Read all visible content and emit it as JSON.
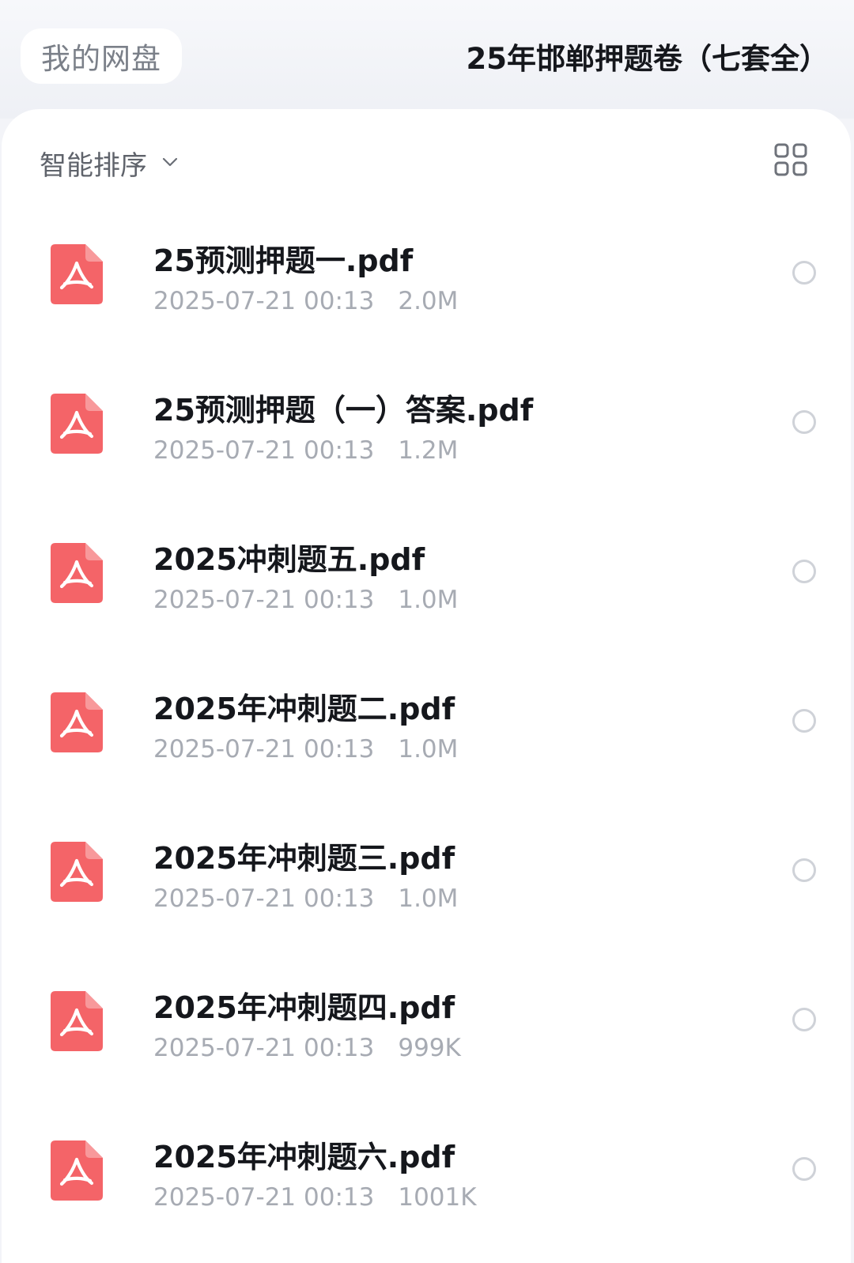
{
  "header": {
    "home_label": "我的网盘",
    "folder_title": "25年邯郸押题卷（七套全）"
  },
  "toolbar": {
    "sort_label": "智能排序",
    "sort_icon": "chevron-down-icon",
    "view_icon": "grid-view-icon"
  },
  "colors": {
    "pdf_icon": "#f46468",
    "accent_text": "#15171c",
    "meta_text": "#a7abb3"
  },
  "files": [
    {
      "name": "25预测押题一.pdf",
      "date": "2025-07-21 00:13",
      "size": "2.0M",
      "icon": "pdf-icon"
    },
    {
      "name": "25预测押题（一）答案.pdf",
      "date": "2025-07-21 00:13",
      "size": "1.2M",
      "icon": "pdf-icon"
    },
    {
      "name": "2025冲刺题五.pdf",
      "date": "2025-07-21 00:13",
      "size": "1.0M",
      "icon": "pdf-icon"
    },
    {
      "name": "2025年冲刺题二.pdf",
      "date": "2025-07-21 00:13",
      "size": "1.0M",
      "icon": "pdf-icon"
    },
    {
      "name": "2025年冲刺题三.pdf",
      "date": "2025-07-21 00:13",
      "size": "1.0M",
      "icon": "pdf-icon"
    },
    {
      "name": "2025年冲刺题四.pdf",
      "date": "2025-07-21 00:13",
      "size": "999K",
      "icon": "pdf-icon"
    },
    {
      "name": "2025年冲刺题六.pdf",
      "date": "2025-07-21 00:13",
      "size": "1001K",
      "icon": "pdf-icon"
    }
  ]
}
